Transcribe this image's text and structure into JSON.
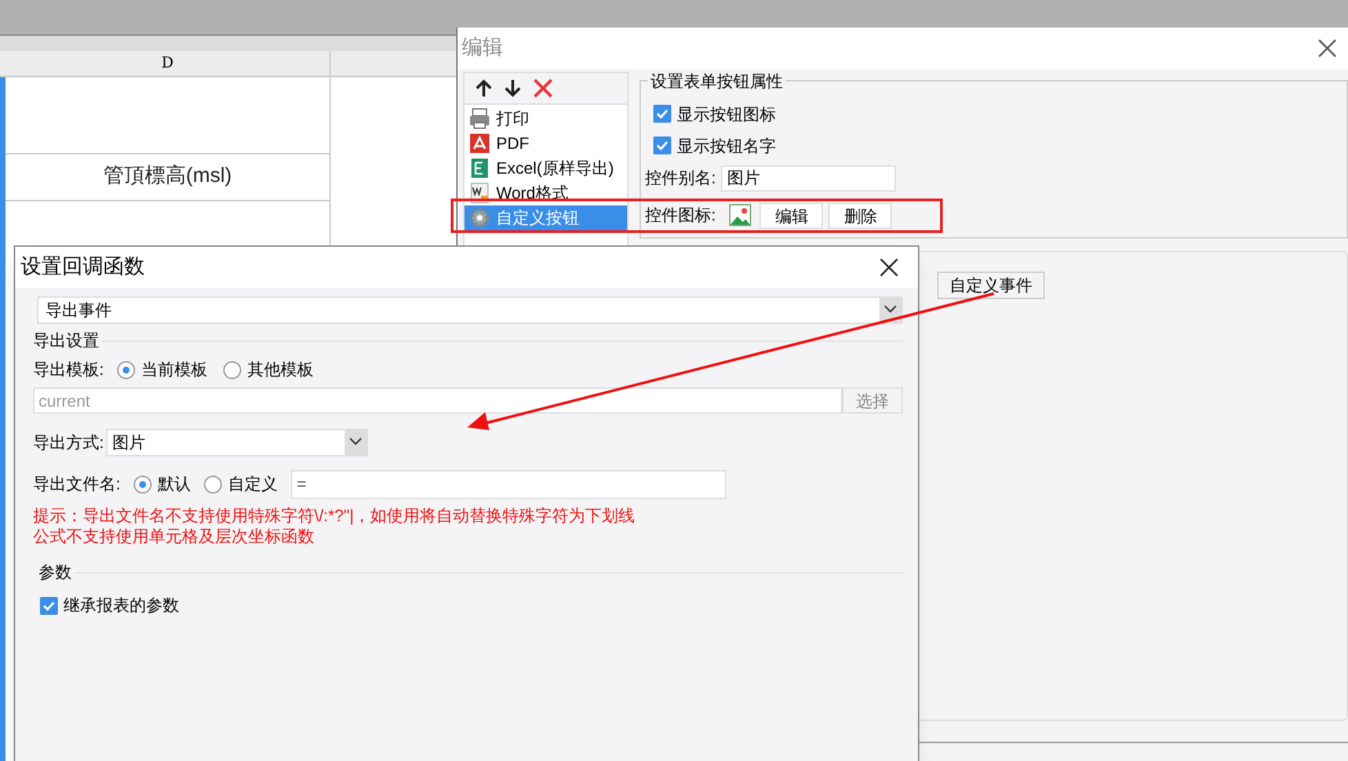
{
  "sheet": {
    "column_header": "D",
    "cell": "管頂標高(msl)"
  },
  "edit_dialog": {
    "title": "编辑",
    "items": [
      {
        "label": "打印",
        "kind": "print",
        "selected": false
      },
      {
        "label": "PDF",
        "kind": "pdf",
        "selected": false
      },
      {
        "label": "Excel(原样导出)",
        "kind": "excel",
        "selected": false
      },
      {
        "label": "Word格式",
        "kind": "word",
        "selected": false
      },
      {
        "label": "自定义按钮",
        "kind": "gear",
        "selected": true
      }
    ],
    "group_title": "设置表单按钮属性",
    "checkboxes": [
      {
        "label": "显示按钮图标",
        "checked": true
      },
      {
        "label": "显示按钮名字",
        "checked": true
      }
    ],
    "alias_label": "控件别名:",
    "alias_value": "图片",
    "icon_label": "控件图标:",
    "icon_buttons": [
      "编辑",
      "删除"
    ],
    "event_button": "自定义事件"
  },
  "callback_dialog": {
    "title": "设置回调函数",
    "event_type": "导出事件",
    "section_export": "导出设置",
    "template_label": "导出模板:",
    "template_options": [
      {
        "label": "当前模板",
        "selected": true
      },
      {
        "label": "其他模板",
        "selected": false
      }
    ],
    "template_placeholder": "current",
    "choose_button": "选择",
    "method_label": "导出方式:",
    "method_value": "图片",
    "filename_label": "导出文件名:",
    "filename_options": [
      {
        "label": "默认",
        "selected": true
      },
      {
        "label": "自定义",
        "selected": false
      }
    ],
    "filename_value": "=",
    "hints": [
      "提示：导出文件名不支持使用特殊字符\\/:*?\"|，如使用将自动替换特殊字符为下划线",
      "公式不支持使用单元格及层次坐标函数"
    ],
    "section_params": "参数",
    "inherit": {
      "label": "继承报表的参数",
      "checked": true
    }
  }
}
